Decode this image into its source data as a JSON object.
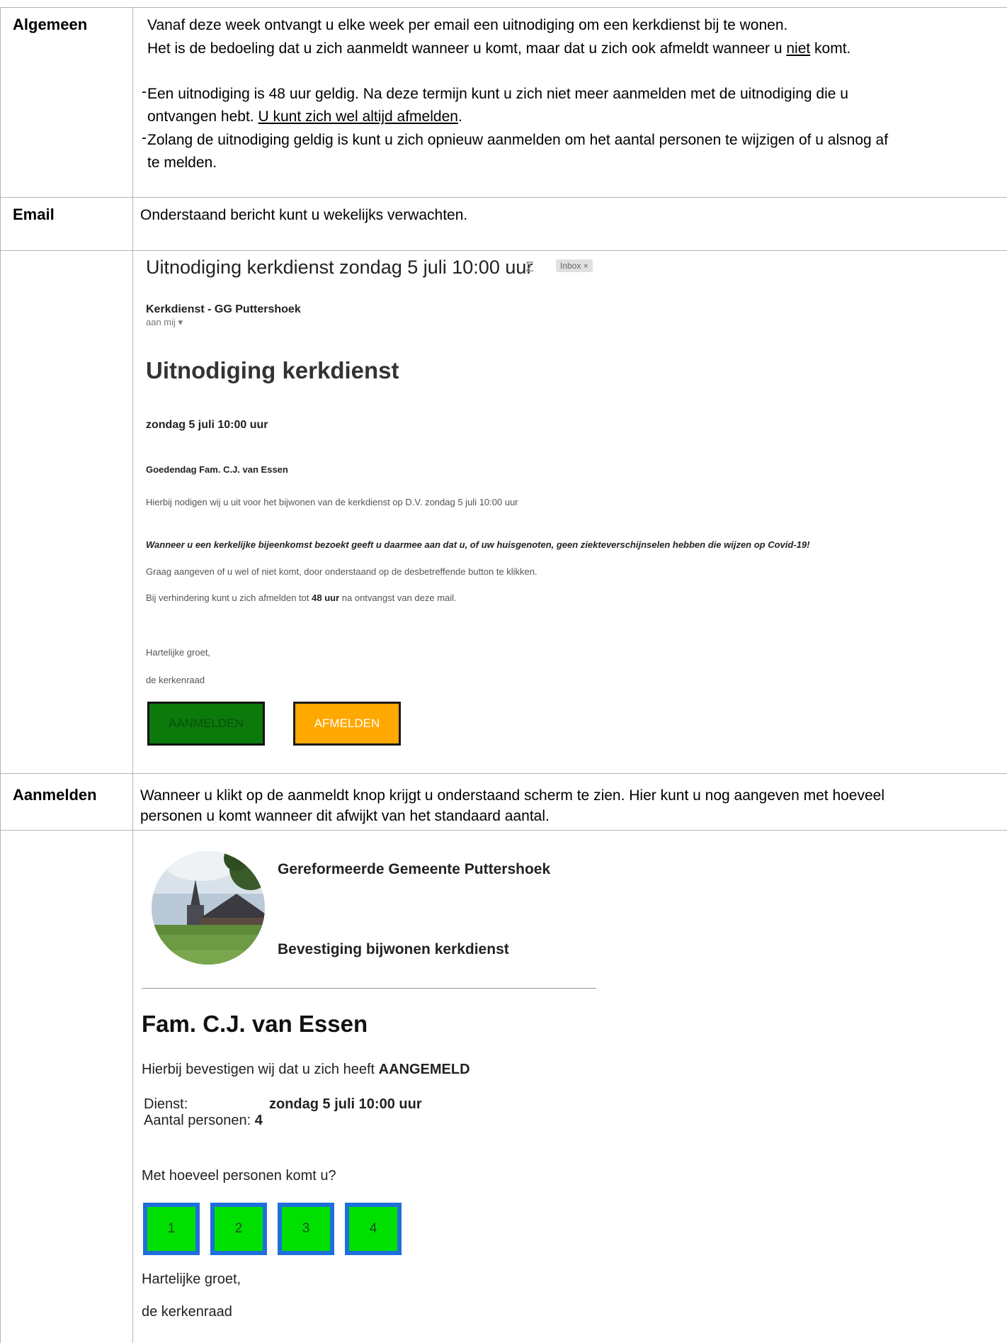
{
  "rows": {
    "algemeen": {
      "label": "Algemeen",
      "line1": "Vanaf deze week ontvangt u elke week per email een uitnodiging om een kerkdienst bij te wonen.",
      "line2_a": "Het is de bedoeling dat u zich aanmeldt wanneer u komt, maar dat u zich ook afmeldt wanneer u ",
      "line2_u": "niet",
      "line2_b": " komt.",
      "b1_line1": "Een uitnodiging is 48 uur geldig. Na deze termijn kunt u zich niet meer aanmelden met de uitnodiging die u",
      "b1_line2_a": "ontvangen hebt. ",
      "b1_line2_u": "U kunt zich wel altijd afmelden",
      "b1_line2_b": ".",
      "b2_line1": "Zolang de uitnodiging geldig is kunt u zich opnieuw aanmelden om het aantal personen te wijzigen of u alsnog af",
      "b2_line2": "te melden.",
      "bullet": "-"
    },
    "email": {
      "label": "Email",
      "text": "Onderstaand bericht kunt u wekelijks verwachten."
    },
    "aanmelden": {
      "label": "Aanmelden",
      "line1": "Wanneer u klikt op de aanmeldt knop krijgt u onderstaand scherm te zien. Hier kunt u nog aangeven met hoeveel",
      "line2": "personen u komt wanneer dit afwijkt van het standaard aantal."
    }
  },
  "mail": {
    "subject": "Uitnodiging kerkdienst zondag 5 juli 10:00 uur",
    "important_icon": "Σ",
    "inbox_tag": "Inbox ×",
    "sender": "Kerkdienst - GG Puttershoek",
    "to": "aan mij ▾",
    "title": "Uitnodiging kerkdienst",
    "date": "zondag 5 juli 10:00 uur",
    "greeting": "Goedendag Fam. C.J. van Essen",
    "invite": "Hierbij nodigen wij u uit voor het bijwonen van de kerkdienst op D.V. zondag 5 juli 10:00 uur",
    "covid": "Wanneer u een kerkelijke bijeenkomst bezoekt geeft u daarmee aan dat u, of uw huisgenoten, geen ziekteverschijnselen hebben die wijzen op Covid-19!",
    "instruction": "Graag aangeven of u wel of niet komt, door onderstaand op de desbetreffende button te klikken.",
    "cancel_a": "Bij verhindering kunt u zich afmelden tot ",
    "cancel_b": "48 uur",
    "cancel_c": " na ontvangst van deze mail.",
    "regards": "Hartelijke groet,",
    "signature": "de kerkenraad",
    "btn_aanmelden": "AANMELDEN",
    "btn_afmelden": "AFMELDEN"
  },
  "confirm": {
    "org": "Gereformeerde Gemeente Puttershoek",
    "subtitle": "Bevestiging bijwonen kerkdienst",
    "family": "Fam. C.J. van Essen",
    "confirm_a": "Hierbij bevestigen wij dat u zich heeft ",
    "confirm_b": "AANGEMELD",
    "dienst_label": "Dienst:",
    "dienst_value": "zondag 5 juli 10:00 uur",
    "aantal_label": "Aantal personen:",
    "aantal_value": "4",
    "question": "Met hoeveel personen komt u?",
    "options": [
      "1",
      "2",
      "3",
      "4"
    ],
    "regards": "Hartelijke groet,",
    "signature": "de kerkenraad"
  }
}
